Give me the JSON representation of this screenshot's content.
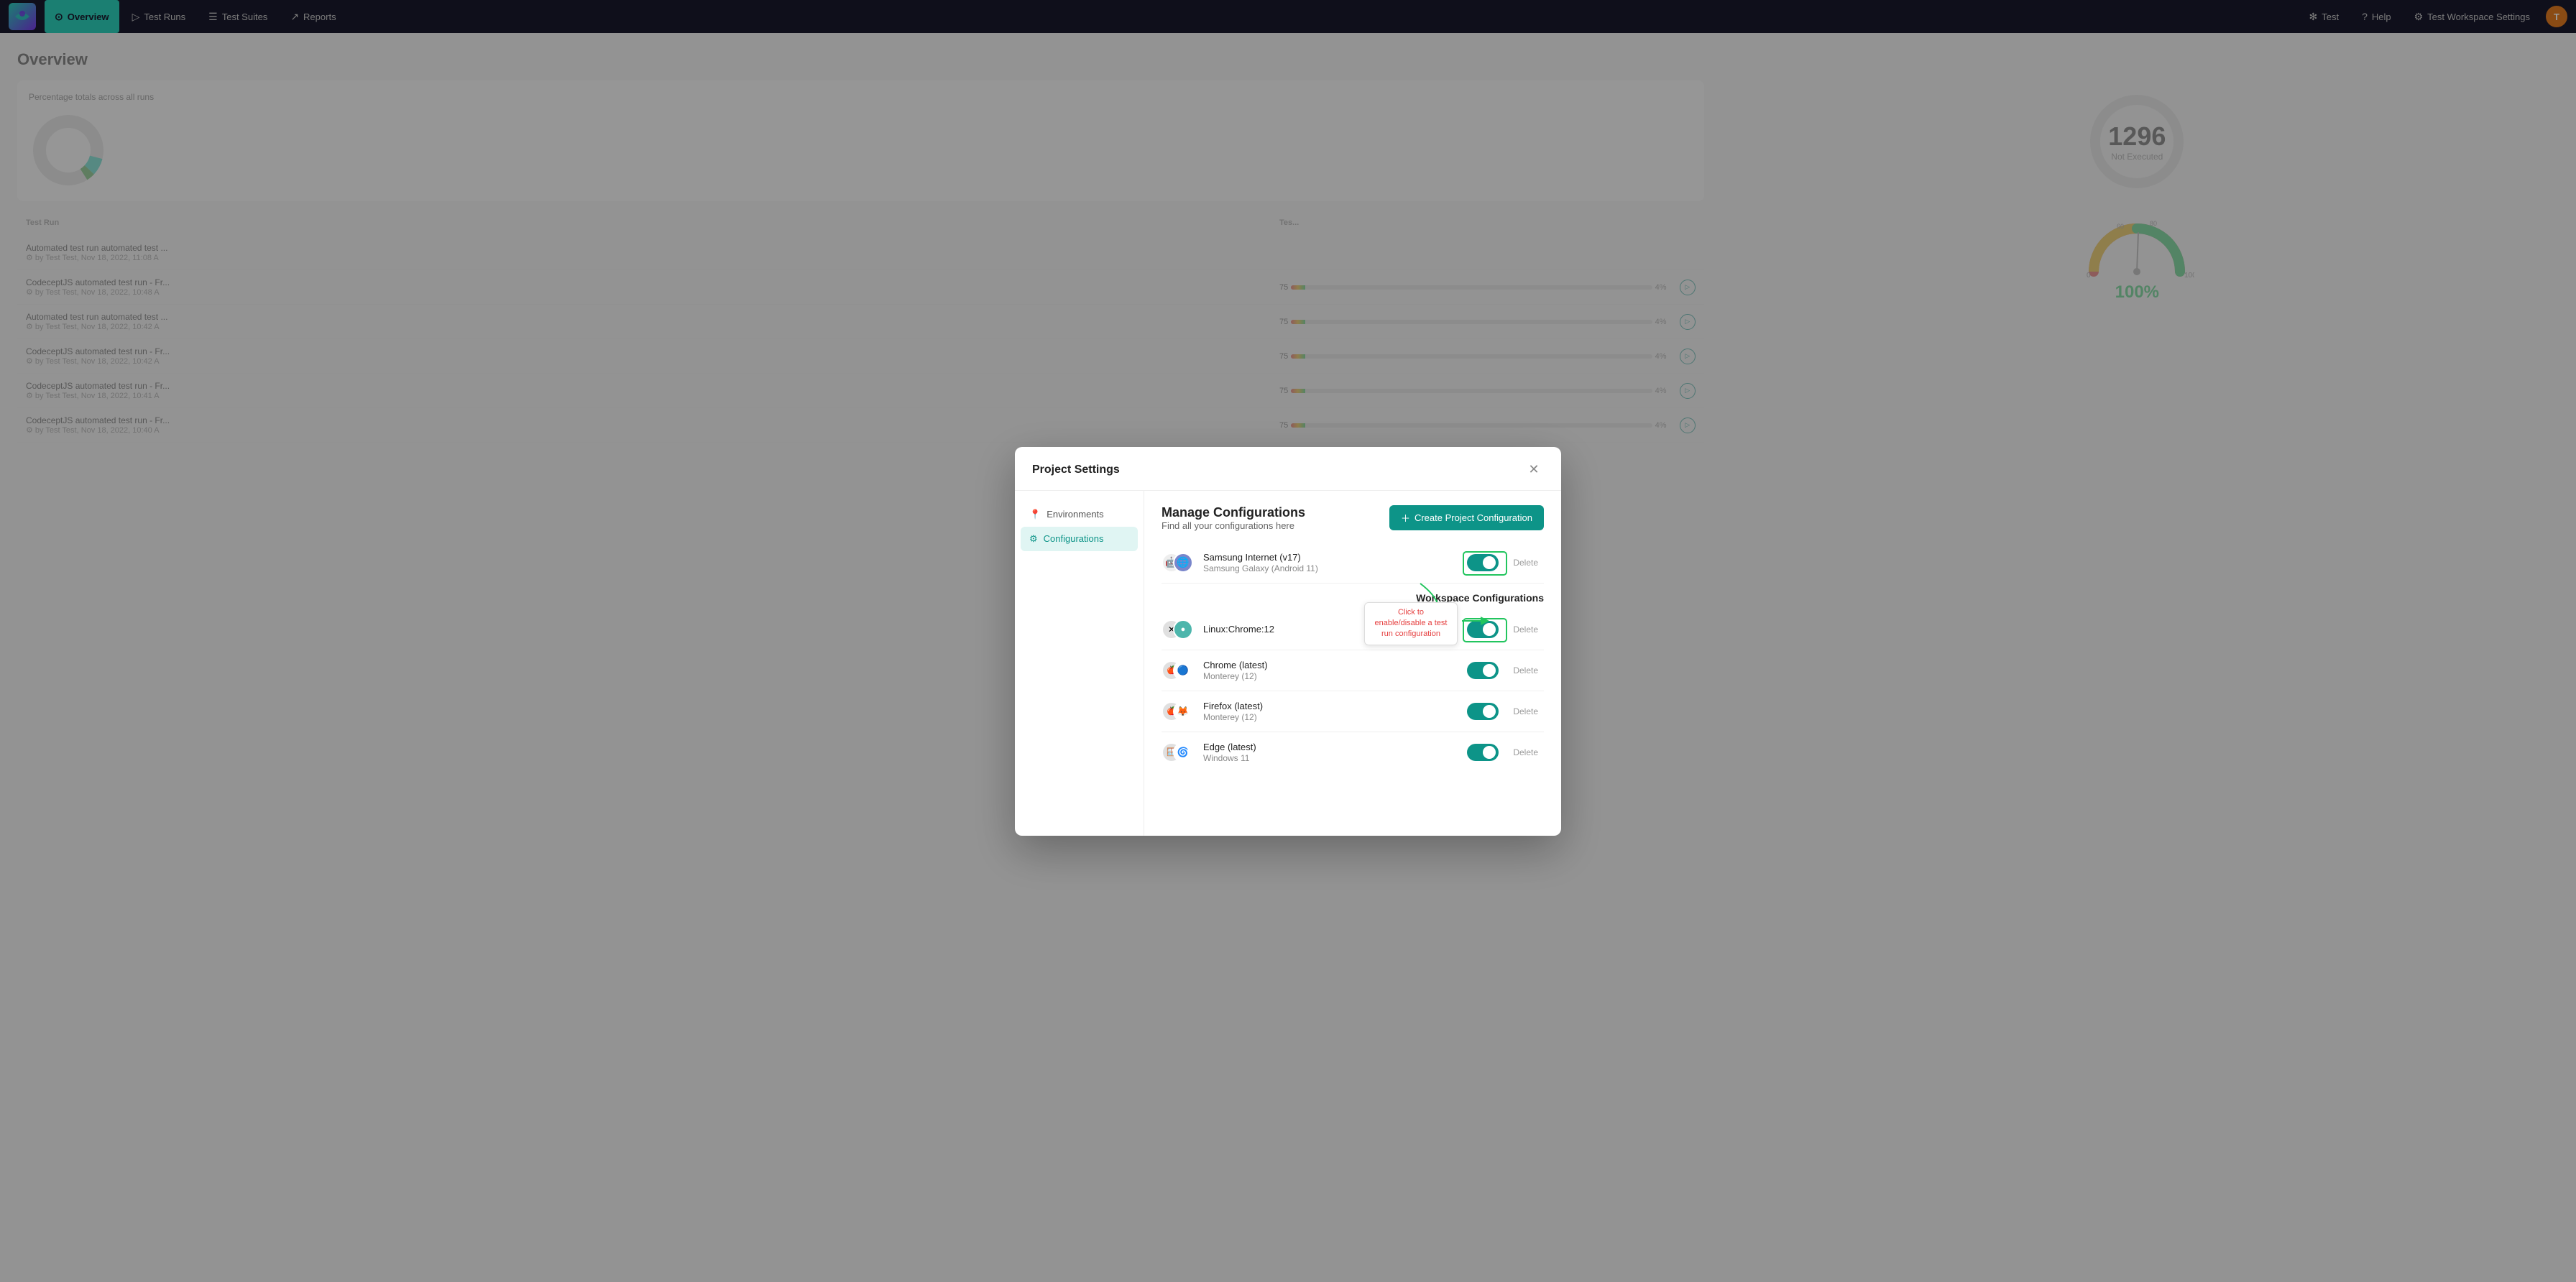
{
  "nav": {
    "logo_text": "qw",
    "items": [
      {
        "label": "Overview",
        "active": true,
        "icon": "⊙"
      },
      {
        "label": "Test Runs",
        "active": false,
        "icon": "▷"
      },
      {
        "label": "Test Suites",
        "active": false,
        "icon": "☰"
      },
      {
        "label": "Reports",
        "active": false,
        "icon": "↗"
      }
    ],
    "right_items": [
      {
        "label": "Test",
        "icon": "✻"
      },
      {
        "label": "Help",
        "icon": "?"
      },
      {
        "label": "Test Workspace Settings",
        "icon": "⚙"
      }
    ],
    "avatar": "T"
  },
  "page": {
    "title": "Overview",
    "subtitle": "Percentage totals across all runs"
  },
  "modal": {
    "title": "Project Settings",
    "sidebar": [
      {
        "label": "Environments",
        "icon": "📍",
        "active": false
      },
      {
        "label": "Configurations",
        "icon": "⚙",
        "active": true
      }
    ],
    "content": {
      "title": "Manage Configurations",
      "subtitle": "Find all your configurations here",
      "create_button": "Create Project Configuration",
      "configs": [
        {
          "name": "Samsung Internet (v17)",
          "sub": "Samsung Galaxy (Android 11)",
          "icon1": "🤖",
          "icon2": "🌐",
          "enabled": true,
          "is_workspace": false
        }
      ],
      "workspace_section_title": "Workspace Configurations",
      "workspace_configs": [
        {
          "name": "Linux:Chrome:12",
          "sub": "",
          "icon1": "🐧",
          "icon2": "🔵",
          "enabled": true
        },
        {
          "name": "Chrome (latest)",
          "sub": "Monterey (12)",
          "icon1": "🍎",
          "icon2": "🔵",
          "enabled": true
        },
        {
          "name": "Firefox (latest)",
          "sub": "Monterey (12)",
          "icon1": "🍎",
          "icon2": "🦊",
          "enabled": true
        },
        {
          "name": "Edge (latest)",
          "sub": "Windows 11",
          "icon1": "🪟",
          "icon2": "🌀",
          "enabled": true
        }
      ],
      "delete_label": "Delete"
    }
  },
  "annotation": {
    "tooltip": "Click to enable/disable a test run configuration"
  },
  "background": {
    "not_executed_count": "1296",
    "not_executed_label": "Not Executed",
    "test_runs": [
      {
        "title": "Automated test run automated test ...",
        "sub": "by Test Test, Nov 18, 2022, 11:08 A",
        "value": "",
        "percent": ""
      },
      {
        "title": "CodeceptJS automated test run - Fr...",
        "sub": "by Test Test, Nov 18, 2022, 10:48 A",
        "value": "75",
        "percent": "4%"
      },
      {
        "title": "Automated test run automated test ...",
        "sub": "by Test Test, Nov 18, 2022, 10:42 A",
        "value": "75",
        "percent": "4%"
      },
      {
        "title": "CodeceptJS automated test run - Fr...",
        "sub": "by Test Test, Nov 18, 2022, 10:42 A",
        "value": "75",
        "percent": "4%"
      },
      {
        "title": "CodeceptJS automated test run - Fr...",
        "sub": "by Test Test, Nov 18, 2022, 10:41 A",
        "value": "75",
        "percent": "4%"
      },
      {
        "title": "CodeceptJS automated test run - Fr...",
        "sub": "by Test Test, Nov 18, 2022, 10:40 A",
        "value": "75",
        "percent": "4%"
      }
    ],
    "gauge_percent": "100%"
  }
}
